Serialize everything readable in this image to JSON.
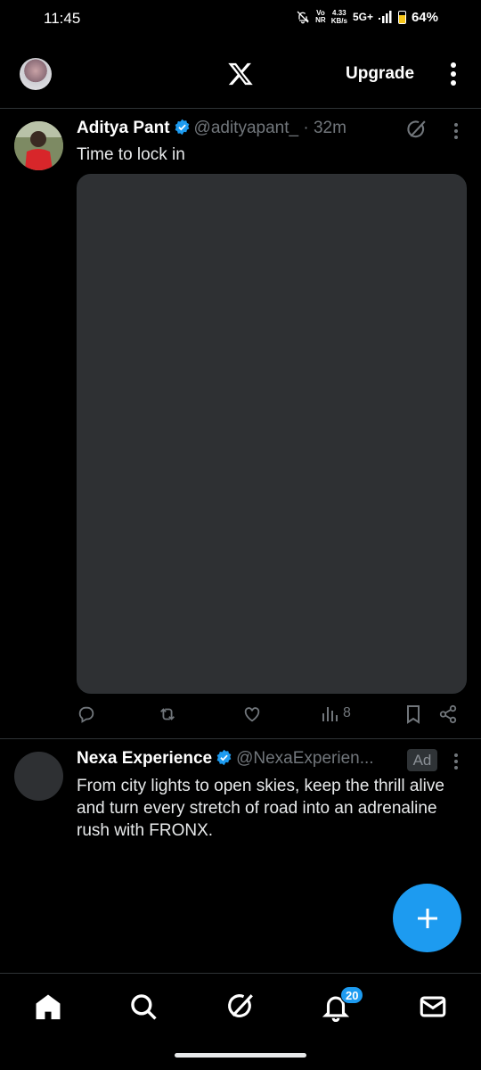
{
  "status_bar": {
    "time": "11:45",
    "network_top": "Vo",
    "network_bottom": "NR",
    "speed_value": "4.33",
    "speed_unit": "KB/s",
    "generation": "5G+",
    "battery_percent": "64%",
    "battery_level": 0.64,
    "battery_color": "#f5c518"
  },
  "header": {
    "logo_icon": "x-logo-icon",
    "upgrade_label": "Upgrade",
    "more_icon": "vertical-dots-icon"
  },
  "tweets": [
    {
      "name": "Aditya Pant",
      "handle": "@adityapant_",
      "time": " · 32m",
      "text": "Time to lock in",
      "verified": true,
      "media_color": "#2e3033",
      "views": "8"
    },
    {
      "name": "Nexa Experience",
      "handle": "@NexaExperien...",
      "ad_label": "Ad",
      "text": "From city lights to open skies, keep the thrill alive and turn every stretch of road into an adrenaline rush with FRONX.",
      "verified": true
    }
  ],
  "bottom_nav": {
    "items": [
      "home-icon",
      "search-icon",
      "grok-icon",
      "notifications-icon",
      "messages-icon"
    ],
    "notifications_badge": "20"
  },
  "colors": {
    "accent": "#1d9bf0",
    "background": "#000000",
    "divider": "#2f3336",
    "secondary_text": "#71767b"
  }
}
